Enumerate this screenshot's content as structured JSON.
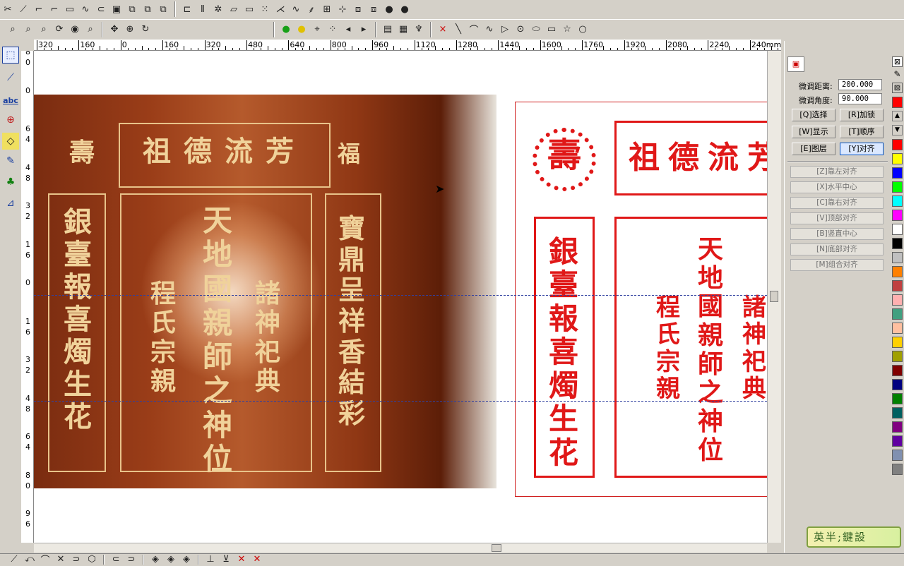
{
  "ruler": {
    "unit": "mm",
    "h_labels": [
      "320",
      "160",
      "0",
      "160",
      "320",
      "480",
      "640",
      "800",
      "960",
      "1120",
      "1280",
      "1440",
      "1600",
      "1760",
      "1920",
      "2080",
      "2240",
      "240mm"
    ],
    "v_labels": [
      "8\n0",
      "0",
      "6\n4",
      "4\n8",
      "3\n2",
      "1\n6",
      "0",
      "1\n6",
      "3\n2",
      "4\n8",
      "6\n4",
      "8\n0",
      "9\n6"
    ]
  },
  "photo_panel": {
    "top_title": "芳流德祖",
    "left_badge": "壽",
    "right_badge": "福",
    "left_column": "銀臺報喜燭生花",
    "right_column": "寶鼎呈祥香結彩",
    "center_main": "天地國親師之神位",
    "center_left": "程氏宗親",
    "center_right": "諸神祀典"
  },
  "design_panel": {
    "top_title": "芳流德祖",
    "badge": "壽",
    "left_column": "銀臺報喜燭生花",
    "center_main": "天地國親師之神位",
    "center_left": "程氏宗親",
    "center_right": "諸神祀典"
  },
  "right_panel": {
    "fine_distance_label": "微调距离:",
    "fine_distance_value": "200.000",
    "fine_angle_label": "微调角度:",
    "fine_angle_value": "90.000",
    "buttons": [
      "[Q]选择",
      "[R]加锁",
      "[W]显示",
      "[T]顺序",
      "[E]图层",
      "[Y]对齐"
    ],
    "align_buttons": [
      "[Z]靠左对齐",
      "[X]水平中心",
      "[C]靠右对齐",
      "[V]顶部对齐",
      "[B]竖直中心",
      "[N]底部对齐",
      "[M]组合对齐"
    ]
  },
  "palette": {
    "colors": [
      "#ff0000",
      "#ffff00",
      "#0000ff",
      "#00ff00",
      "#00ffff",
      "#ff00ff",
      "#ffffff",
      "#000000",
      "#c0c0c0",
      "#ff8000",
      "#c04040",
      "#ffb0b0",
      "#40a080",
      "#ffc0a0",
      "#ffd000",
      "#a0a000",
      "#800000",
      "#000080",
      "#008000",
      "#006060",
      "#800080",
      "#6000a0",
      "#8090b0",
      "#808080"
    ]
  },
  "watermark": {
    "text": "英半;鍵設"
  }
}
